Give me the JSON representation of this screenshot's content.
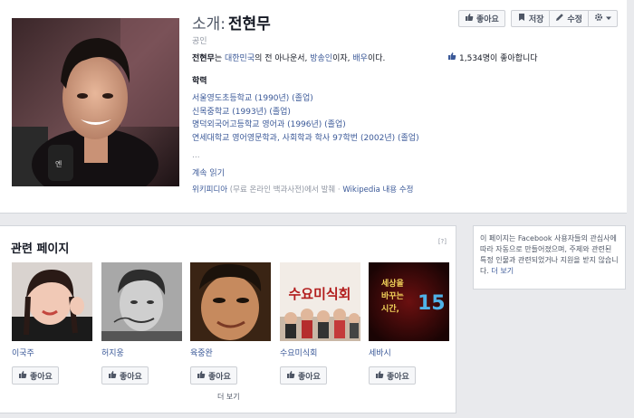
{
  "profile": {
    "title_prefix": "소개:",
    "name": "전현무",
    "category": "공인",
    "desc_name": "전현무",
    "desc_mid1": "는 ",
    "desc_link1": "대한민국",
    "desc_mid2": "의 전 아나운서, ",
    "desc_link2": "방송인",
    "desc_mid3": "이자, ",
    "desc_link3": "배우",
    "desc_end": "이다.",
    "likes_text": "1,534명이 좋아합니다",
    "section_head": "학력",
    "education": [
      "서울영도초등학교 (1990년) (졸업)",
      "신목중학교 (1993년) (졸업)",
      "명덕외국어고등학교 영어과 (1996년) (졸업)",
      "연세대학교 영어영문학과, 사회학과 학사 97학번 (2002년) (졸업)"
    ],
    "ellipsis": "...",
    "read_more": "계속 읽기",
    "source_link1": "위키피디아",
    "source_text": " (무료 온라인 백과사전)에서 발췌 · ",
    "source_link2": "Wikipedia 내용 수정"
  },
  "buttons": {
    "like": "좋아요",
    "save": "저장",
    "edit": "수정",
    "settings_icon": "gear-icon"
  },
  "related": {
    "title": "관련 페이지",
    "help": "[?]",
    "pages": [
      {
        "name": "이국주",
        "like": "좋아요"
      },
      {
        "name": "허지웅",
        "like": "좋아요"
      },
      {
        "name": "육중완",
        "like": "좋아요"
      },
      {
        "name": "수요미식회",
        "like": "좋아요"
      },
      {
        "name": "세바시",
        "like": "좋아요"
      }
    ],
    "thumb_texts": {
      "soyo": "수요미식회",
      "sebasi_1": "세상을",
      "sebasi_2": "바꾸는",
      "sebasi_3": "시간,",
      "sebasi_num": "15"
    },
    "more": "더 보기"
  },
  "info": {
    "text": "이 페이지는 Facebook 사용자들의 관심사에 따라 자동으로 만들어졌으며, 주제와 관련된 특정 인물과 관련되었거나 지원을 받지 않습니다. ",
    "link": "더 보기"
  },
  "colors": {
    "link": "#3b5998",
    "background": "#e9eaed"
  }
}
